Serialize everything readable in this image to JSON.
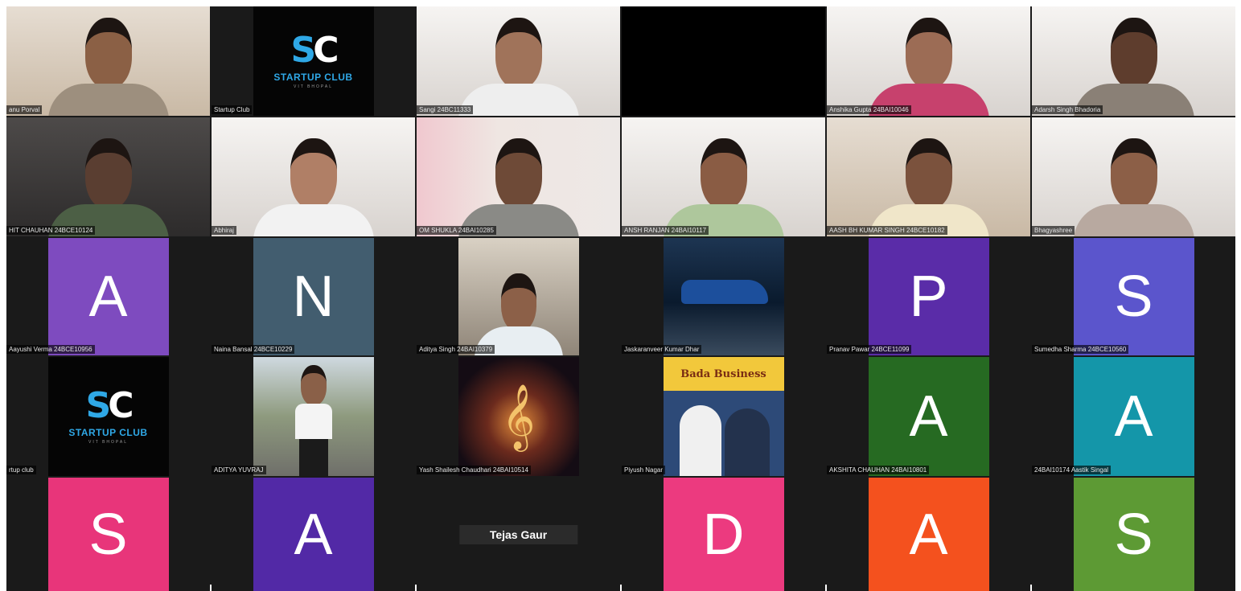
{
  "meeting": {
    "row1": [
      {
        "label": "anu Porval"
      },
      {
        "label": "Startup Club"
      },
      {
        "label": "Sangi 24BC11333"
      },
      {
        "label": ""
      },
      {
        "label": "Anshika Gupta 24BAI10046"
      },
      {
        "label": "Adarsh Singh Bhadoria"
      }
    ],
    "row2": [
      {
        "label": "HIT CHAUHAN 24BCE10124"
      },
      {
        "label": "Abhiraj"
      },
      {
        "label": "OM SHUKLA 24BAI10285"
      },
      {
        "label": "ANSH RANJAN 24BAI10117"
      },
      {
        "label": "AASH BH KUMAR SINGH 24BCE10182"
      },
      {
        "label": "Bhagyashree"
      }
    ],
    "row3": [
      {
        "initial": "A",
        "color": "#7e4bbf",
        "label": "Aayushi Verma 24BCE10956"
      },
      {
        "initial": "N",
        "color": "#425d6f",
        "label": "Naina Bansal 24BCE10229"
      },
      {
        "label": "Aditya Singh 24BAI10379"
      },
      {
        "label": "Jaskaranveer Kumar Dhar"
      },
      {
        "initial": "P",
        "color": "#5a2ca8",
        "label": "Pranav Pawar 24BCE11099"
      },
      {
        "initial": "S",
        "color": "#5b55cc",
        "label": "Sumedha Sharma 24BCE10560"
      }
    ],
    "row4": [
      {
        "label": "rtup club"
      },
      {
        "label": "ADITYA YUVRAJ"
      },
      {
        "label": "Yash Shailesh Chaudhari 24BAI10514"
      },
      {
        "label": "Piyush Nagar"
      },
      {
        "initial": "A",
        "color": "#266a22",
        "label": "AKSHITA CHAUHAN 24BAI10801"
      },
      {
        "initial": "A",
        "color": "#1496a9",
        "label": "24BAI10174 Aastik Singal"
      }
    ],
    "row5": [
      {
        "initial": "S",
        "color": "#e8357a",
        "label": ""
      },
      {
        "initial": "A",
        "color": "#5229a6",
        "label": ""
      },
      {
        "name": "Tejas Gaur"
      },
      {
        "initial": "D",
        "color": "#ec3a7f",
        "label": ""
      },
      {
        "initial": "A",
        "color": "#f4511e",
        "label": ""
      },
      {
        "initial": "S",
        "color": "#5d9a34",
        "label": ""
      }
    ],
    "logo": {
      "mark_s": "S",
      "mark_c": "C",
      "text": "STARTUP CLUB",
      "sub": "VIT BHOPAL"
    },
    "book_title": "Bada Business"
  }
}
